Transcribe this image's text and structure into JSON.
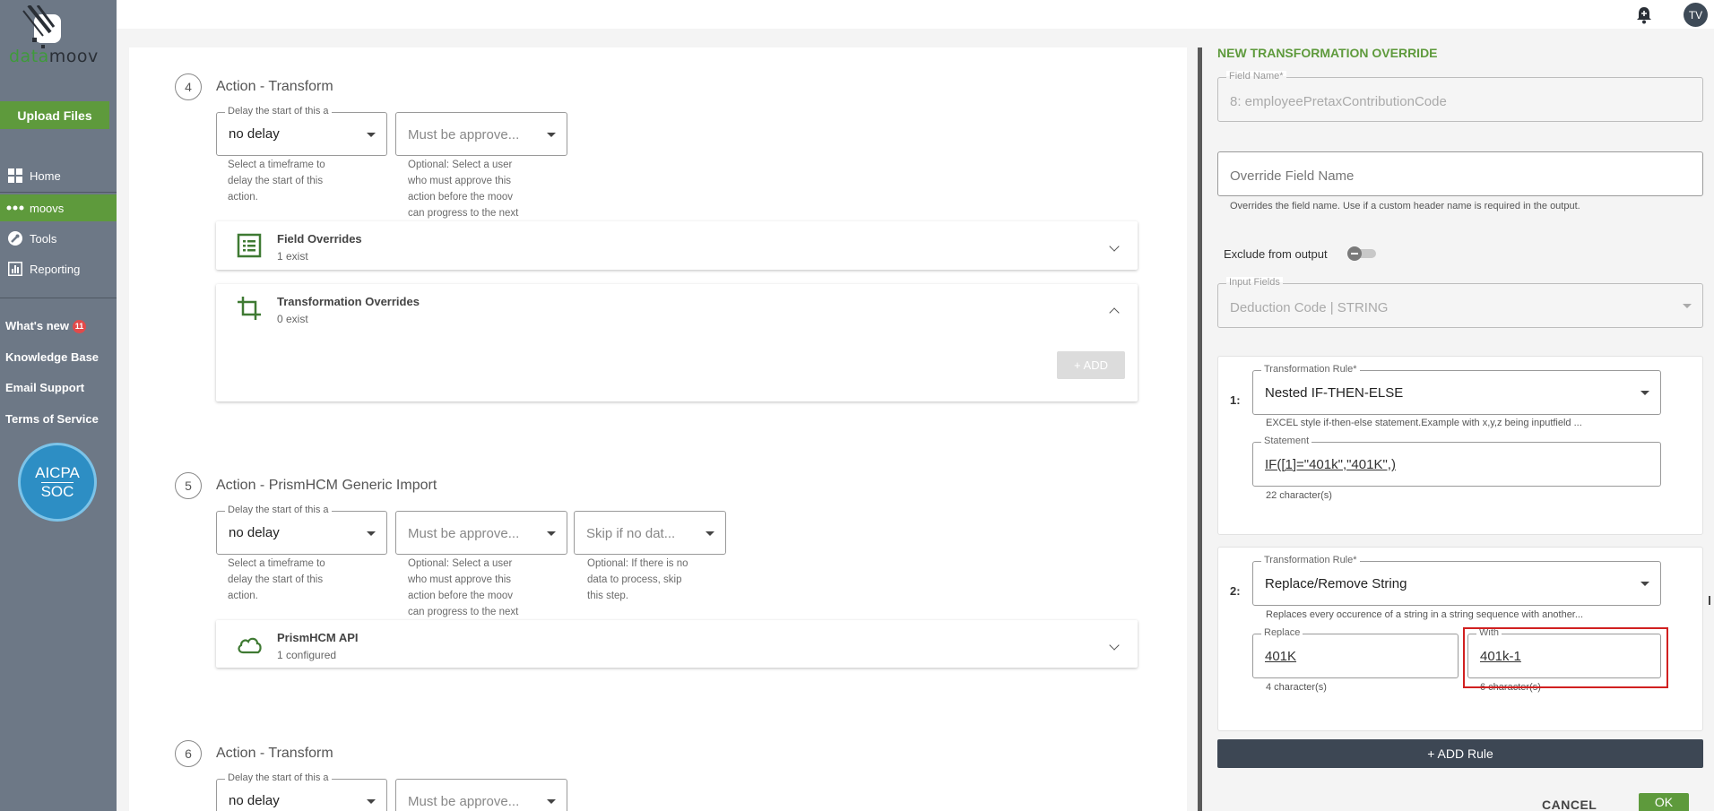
{
  "sidebar": {
    "logo": {
      "part1": "data",
      "part2": "moov"
    },
    "upload_label": "Upload Files",
    "nav": [
      {
        "label": "Home",
        "icon": "home-grid-icon"
      },
      {
        "label": "moovs",
        "icon": "moovs-dots-icon"
      },
      {
        "label": "Tools",
        "icon": "wrench-icon"
      },
      {
        "label": "Reporting",
        "icon": "bar-chart-icon"
      }
    ],
    "links": [
      {
        "label": "What's new",
        "badge": "11"
      },
      {
        "label": "Knowledge Base"
      },
      {
        "label": "Email Support"
      },
      {
        "label": "Terms of Service"
      }
    ],
    "soc_badge": {
      "top": "AICPA",
      "bottom": "SOC"
    }
  },
  "header": {
    "avatar_initials": "TV",
    "bell_icon": "bell-icon"
  },
  "steps": [
    {
      "number": "4",
      "title": "Action - Transform",
      "delay_label": "Delay the start of this a",
      "delay_value": "no delay",
      "delay_help": [
        "Select a timeframe to",
        "delay the start of this",
        "action."
      ],
      "approve_placeholder": "Must be approve...",
      "approve_help": [
        "Optional: Select a user",
        "who must approve this",
        "action before the moov",
        "can progress to the next"
      ],
      "cards": [
        {
          "title": "Field Overrides",
          "subtitle": "1 exist",
          "icon": "list-icon"
        },
        {
          "title": "Transformation Overrides",
          "subtitle": "0 exist",
          "icon": "crop-icon",
          "add_label": "+ ADD"
        }
      ]
    },
    {
      "number": "5",
      "title": "Action - PrismHCM Generic Import",
      "delay_label": "Delay the start of this a",
      "delay_value": "no delay",
      "delay_help": [
        "Select a timeframe to",
        "delay the start of this",
        "action."
      ],
      "approve_placeholder": "Must be approve...",
      "approve_help": [
        "Optional: Select a user",
        "who must approve this",
        "action before the moov",
        "can progress to the next"
      ],
      "skip_placeholder": "Skip if no dat...",
      "skip_help": [
        "Optional: If there is no",
        "data to process, skip",
        "this step."
      ],
      "cards": [
        {
          "title": "PrismHCM API",
          "subtitle": "1 configured",
          "icon": "cloud-icon"
        }
      ]
    },
    {
      "number": "6",
      "title": "Action - Transform",
      "delay_label": "Delay the start of this a",
      "delay_value": "no delay",
      "approve_placeholder": "Must be approve..."
    }
  ],
  "override_panel": {
    "title": "NEW TRANSFORMATION OVERRIDE",
    "field_name_label": "Field Name*",
    "field_name_value": "8: employeePretaxContributionCode",
    "override_placeholder": "Override Field Name",
    "override_help": "Overrides the field name. Use if a custom header name is required in the output.",
    "exclude_label": "Exclude from output",
    "input_fields_label": "Input Fields",
    "input_fields_value": "Deduction Code | STRING",
    "rules": [
      {
        "number": "1:",
        "rule_label": "Transformation Rule*",
        "rule_value": "Nested IF-THEN-ELSE",
        "rule_help": "EXCEL style if-then-else statement.Example with x,y,z being inputfield ...",
        "statement_label": "Statement",
        "statement_value": "IF([1]=\"401k\",\"401K\",)",
        "char_count": "22 character(s)"
      },
      {
        "number": "2:",
        "rule_label": "Transformation Rule*",
        "rule_value": "Replace/Remove String",
        "rule_help": "Replaces every occurence of a string in a string sequence with another...",
        "replace_label": "Replace",
        "replace_value": "401K",
        "with_label": "With",
        "with_value": "401k-1",
        "replace_count": "4 character(s)",
        "with_count": "6 character(s)"
      }
    ],
    "add_rule_label": "+ ADD Rule",
    "cancel_label": "CANCEL",
    "ok_label": "OK"
  },
  "colors": {
    "brand_green": "#5e9a3c",
    "sidebar": "#6d7886",
    "highlight": "#d12020",
    "dark_button": "#3d4754"
  }
}
